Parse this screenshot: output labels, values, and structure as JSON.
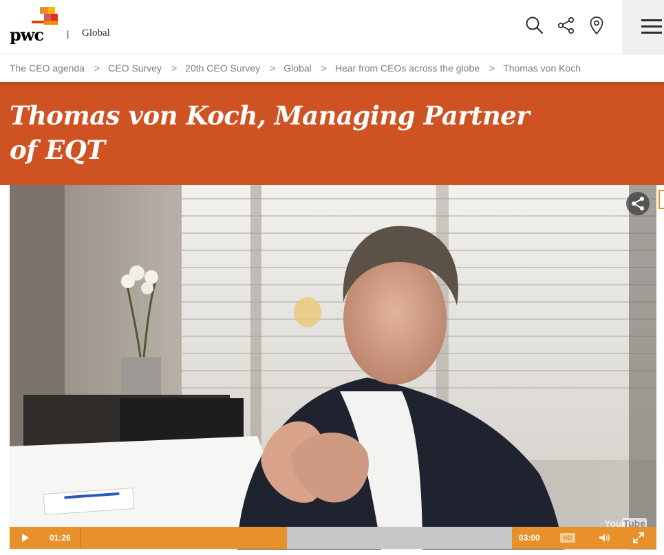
{
  "header": {
    "logo_text": "pwc",
    "separator": "|",
    "region": "Global",
    "icons": [
      "search-icon",
      "share-icon",
      "location-icon",
      "menu-icon"
    ]
  },
  "breadcrumb": {
    "items": [
      "The CEO agenda",
      "CEO Survey",
      "20th CEO Survey",
      "Global",
      "Hear from CEOs across the globe",
      "Thomas von Koch"
    ],
    "separator": ">"
  },
  "page": {
    "title_line1": "Thomas von Koch, Managing Partner",
    "title_line2": "of EQT"
  },
  "video": {
    "current_time": "01:26",
    "total_time": "03:00",
    "progress_fraction": 0.478,
    "hd_label": "HD",
    "watermark_a": "You",
    "watermark_b": "Tube"
  },
  "colors": {
    "brand_orange": "#cf5322",
    "player_orange": "#e8912a",
    "breadcrumb_text": "#7d7d7d"
  }
}
